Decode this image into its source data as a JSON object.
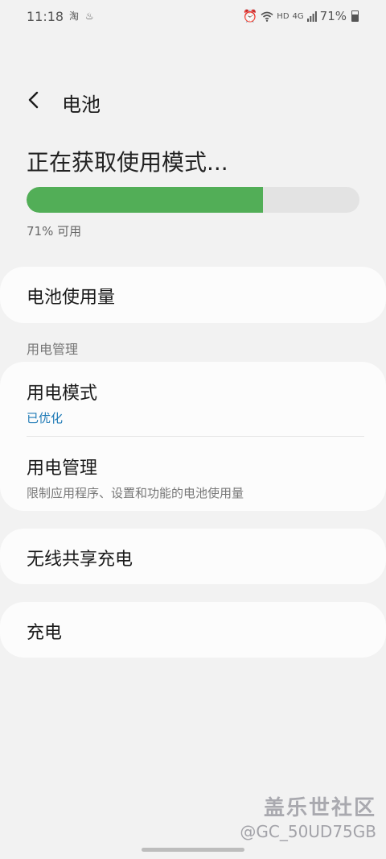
{
  "status_bar": {
    "time": "11:18",
    "left_icons": "淘 ♨",
    "hd": "HD",
    "net": "4G",
    "battery": "71%"
  },
  "header": {
    "title": "电池"
  },
  "battery": {
    "mode_title": "正在获取使用模式...",
    "level_percent": 71,
    "available_label": "71% 可用"
  },
  "items": {
    "usage": "电池使用量",
    "section_label": "用电管理",
    "power_mode": {
      "title": "用电模式",
      "status": "已优化"
    },
    "power_mgmt": {
      "title": "用电管理",
      "subtitle": "限制应用程序、设置和功能的电池使用量"
    },
    "wireless_share": "无线共享充电",
    "charging": "充电"
  },
  "watermark": {
    "brand": "盖乐世社区",
    "user": "@GC_50UD75GB"
  },
  "colors": {
    "accent_green": "#52ae57",
    "link_blue": "#1e7ab6"
  }
}
